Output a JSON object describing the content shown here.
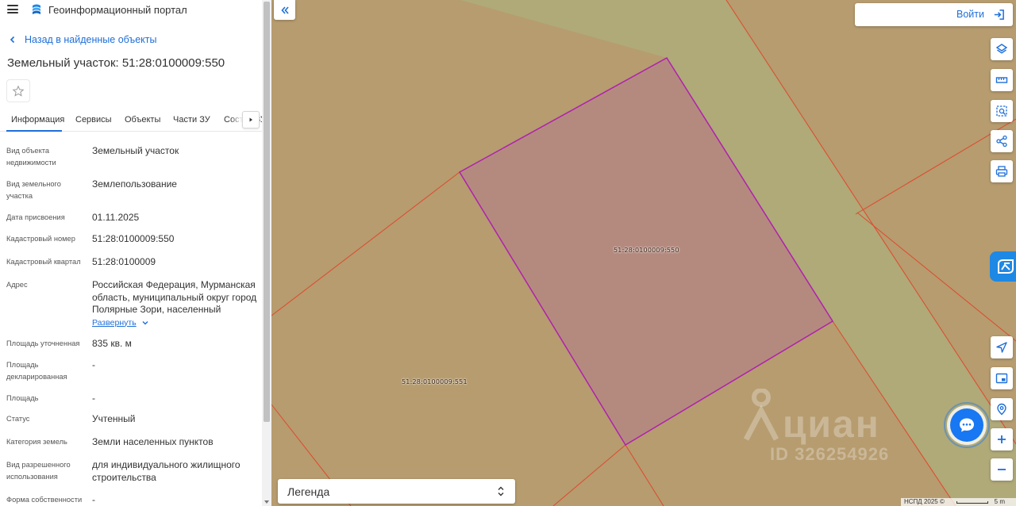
{
  "header": {
    "portal_title": "Геоинформационный портал",
    "menu_icon": "hamburger-icon",
    "logo_icon": "portal-logo-icon"
  },
  "object": {
    "back_label": "Назад в найденные объекты",
    "title": "Земельный участок: 51:28:0100009:550"
  },
  "tabs": [
    {
      "label": "Информация",
      "active": true
    },
    {
      "label": "Сервисы"
    },
    {
      "label": "Объекты"
    },
    {
      "label": "Части ЗУ"
    },
    {
      "label": "Состав ЗУ"
    }
  ],
  "properties": [
    {
      "label": "Вид объекта недвижимости",
      "value": "Земельный участок"
    },
    {
      "label": "Вид земельного участка",
      "value": "Землепользование"
    },
    {
      "label": "Дата присвоения",
      "value": "01.11.2025"
    },
    {
      "label": "Кадастровый номер",
      "value": "51:28:0100009:550"
    },
    {
      "label": "Кадастровый квартал",
      "value": "51:28:0100009"
    },
    {
      "label": "Адрес",
      "value": "Российская Федерация, Мурманская область, муниципальный округ город Полярные Зори, населенный",
      "expand_label": "Развернуть"
    },
    {
      "label": "Площадь уточненная",
      "value": "835 кв. м"
    },
    {
      "label": "Площадь декларированная",
      "value": "-"
    },
    {
      "label": "Площадь",
      "value": "-"
    },
    {
      "label": "Статус",
      "value": "Учтенный"
    },
    {
      "label": "Категория земель",
      "value": "Земли населенных пунктов"
    },
    {
      "label": "Вид разрешенного использования",
      "value": "для индивидуального жилищного строительства"
    },
    {
      "label": "Форма собственности",
      "value": "-"
    }
  ],
  "map": {
    "login_label": "Войти",
    "legend_label": "Легенда",
    "parcel_selected": "51:28:0100009:550",
    "parcel_neighbor": "51:28:0100009:551",
    "watermark_brand": "циан",
    "watermark_id": "ID 326254926",
    "attribution": "НСПД 2025 ©",
    "scale_label": "5 m",
    "colors": {
      "ground": "#b69c6f",
      "road": "#b0a978",
      "selected_fill": "#b58a7e",
      "selected_stroke": "#b020b0",
      "boundary": "#e0482c",
      "accent": "#1e6fd9"
    },
    "tools": [
      "layers-icon",
      "ruler-icon",
      "area-select-icon",
      "share-icon",
      "print-icon",
      "locate-icon",
      "minimap-icon",
      "geo-search-icon",
      "zoom-in-icon",
      "zoom-out-icon"
    ]
  }
}
